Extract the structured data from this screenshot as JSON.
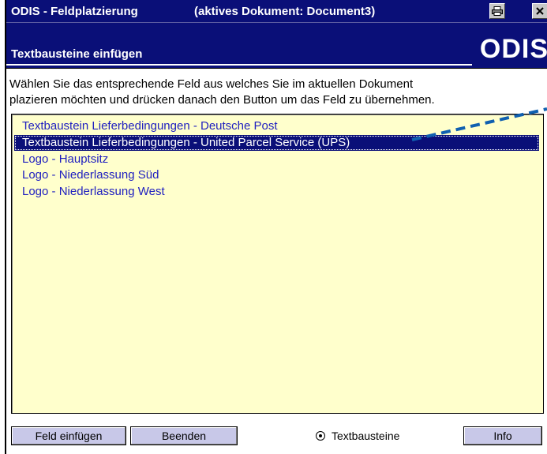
{
  "titlebar": {
    "app_title": "ODIS - Feldplatzierung",
    "document_label": "(aktives Dokument: Document3)",
    "print_icon": "printer-icon",
    "close_icon": "close-icon"
  },
  "header": {
    "section_title": "Textbausteine einfügen",
    "logo_text": "ODIS"
  },
  "instructions": {
    "line1": "Wählen Sie das entsprechende Feld aus welches Sie im aktuellen Dokument",
    "line2": "plazieren möchten und drücken danach den Button um das Feld zu übernehmen."
  },
  "list": {
    "items": [
      "Textbaustein Lieferbedingungen - Deutsche Post",
      "Textbaustein Lieferbedingungen - United Parcel Service (UPS)",
      "Logo - Hauptsitz",
      "Logo - Niederlassung Süd",
      "Logo - Niederlassung West"
    ],
    "selected_index": 1
  },
  "footer": {
    "insert_button": "Feld einfügen",
    "quit_button": "Beenden",
    "radio_label": "Textbausteine",
    "radio_checked": true,
    "info_button": "Info"
  },
  "colors": {
    "header_bg": "#0a0f78",
    "list_bg": "#ffffcc",
    "list_text": "#2020c0",
    "button_bg": "#c8c8e8",
    "arrow": "#1060b0"
  }
}
